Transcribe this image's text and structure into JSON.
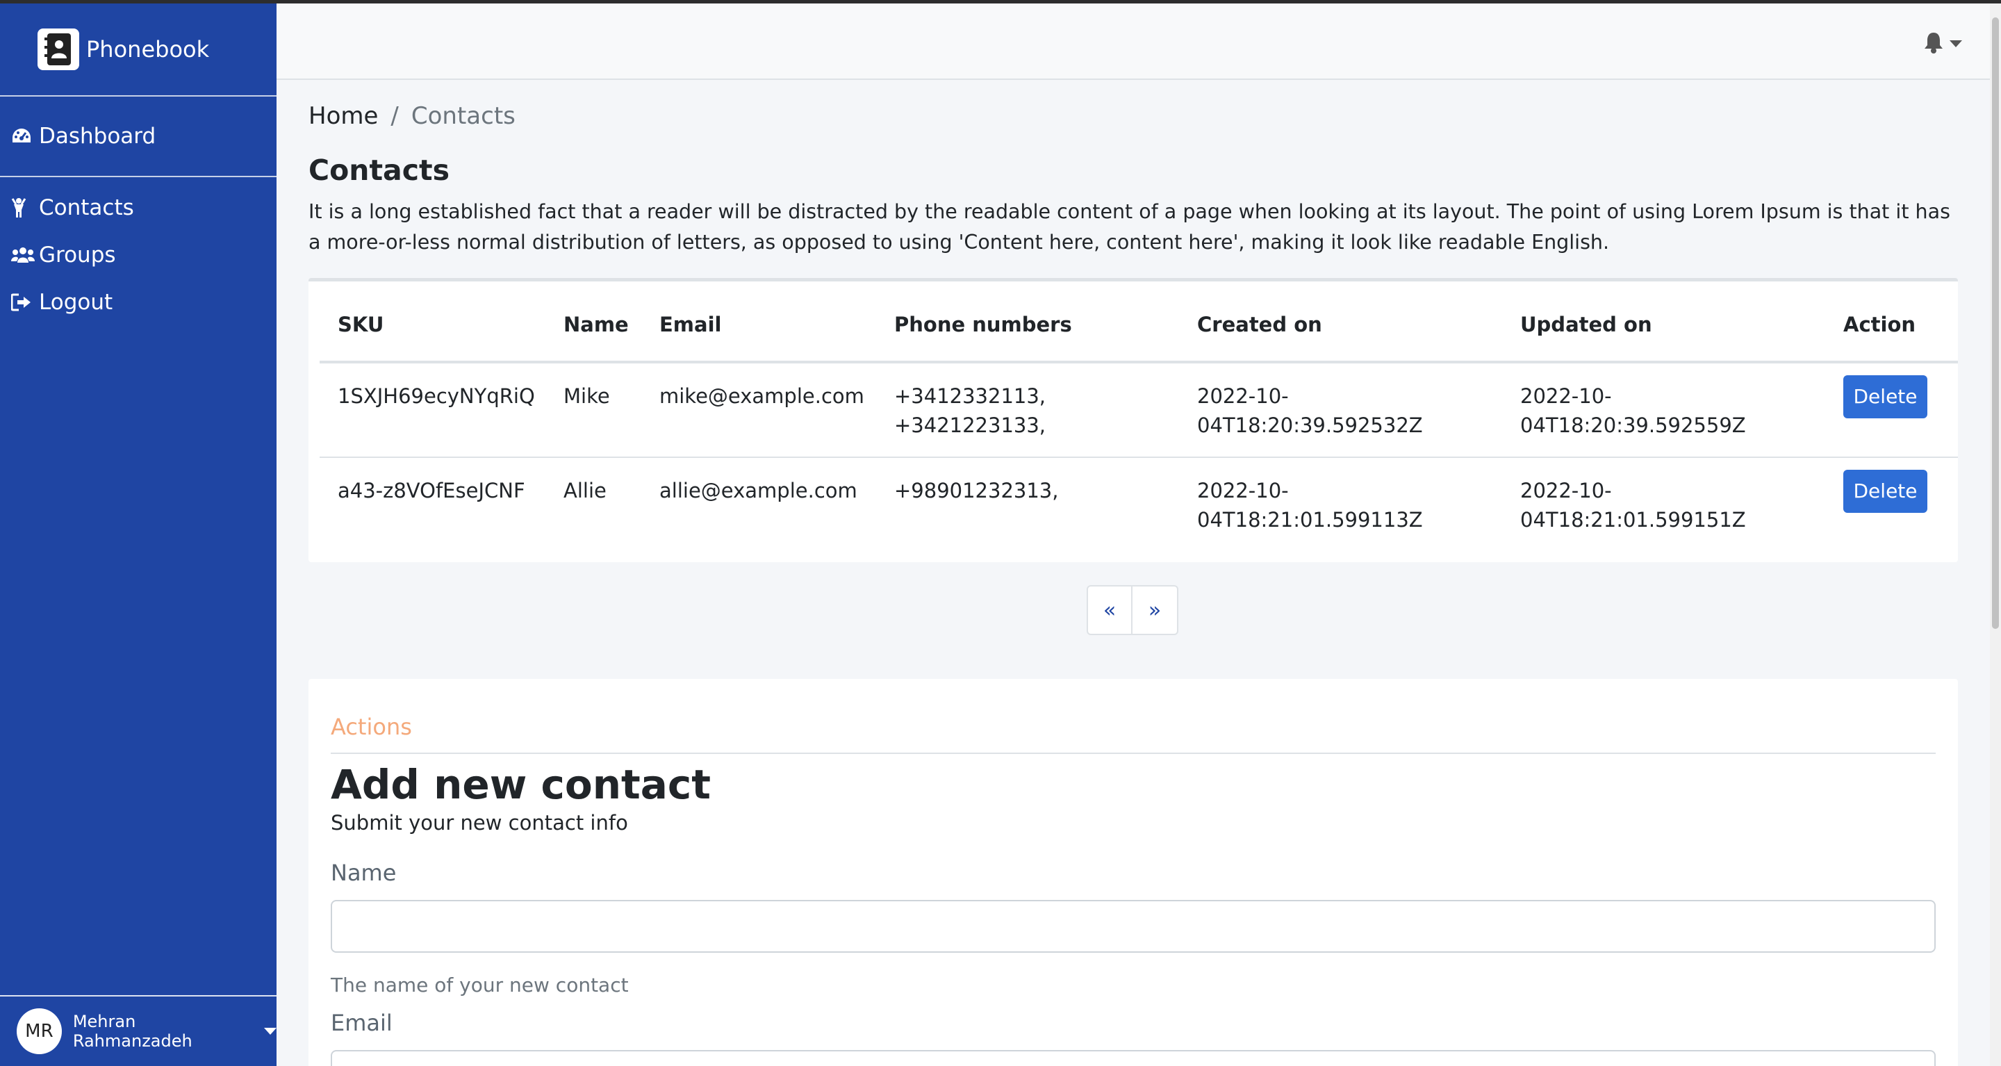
{
  "app": {
    "brand": "Phonebook"
  },
  "sidebar": {
    "dashboard": "Dashboard",
    "items": [
      {
        "label": "Contacts",
        "icon": "child-icon"
      },
      {
        "label": "Groups",
        "icon": "users-icon"
      },
      {
        "label": "Logout",
        "icon": "sign-out-icon"
      }
    ],
    "user": {
      "initials": "MR",
      "name": "Mehran Rahmanzadeh"
    }
  },
  "breadcrumb": {
    "home": "Home",
    "separator": "/",
    "current": "Contacts"
  },
  "page": {
    "title": "Contacts",
    "description": "It is a long established fact that a reader will be distracted by the readable content of a page when looking at its layout. The point of using Lorem Ipsum is that it has a more-or-less normal distribution of letters, as opposed to using 'Content here, content here', making it look like readable English."
  },
  "table": {
    "headers": [
      "SKU",
      "Name",
      "Email",
      "Phone numbers",
      "Created on",
      "Updated on",
      "Action"
    ],
    "rows": [
      {
        "sku": "1SXJH69ecyNYqRiQ",
        "name": "Mike",
        "email": "mike@example.com",
        "phone1": "+3412332113,",
        "phone2": "+3421223133,",
        "created1": "2022-10-",
        "created2": "04T18:20:39.592532Z",
        "updated1": "2022-10-",
        "updated2": "04T18:20:39.592559Z",
        "action": "Delete"
      },
      {
        "sku": "a43-z8VOfEseJCNF",
        "name": "Allie",
        "email": "allie@example.com",
        "phone1": "+98901232313,",
        "phone2": "",
        "created1": "2022-10-",
        "created2": "04T18:21:01.599113Z",
        "updated1": "2022-10-",
        "updated2": "04T18:21:01.599151Z",
        "action": "Delete"
      }
    ]
  },
  "pagination": {
    "prev": "«",
    "next": "»"
  },
  "form": {
    "section_label": "Actions",
    "title": "Add new contact",
    "subtitle": "Submit your new contact info",
    "name_label": "Name",
    "name_value": "",
    "name_help": "The name of your new contact",
    "email_label": "Email",
    "email_value": ""
  },
  "colors": {
    "sidebar": "#1f45a3",
    "primary_button": "#2e6dd6",
    "actions_label": "#f4a97b"
  }
}
